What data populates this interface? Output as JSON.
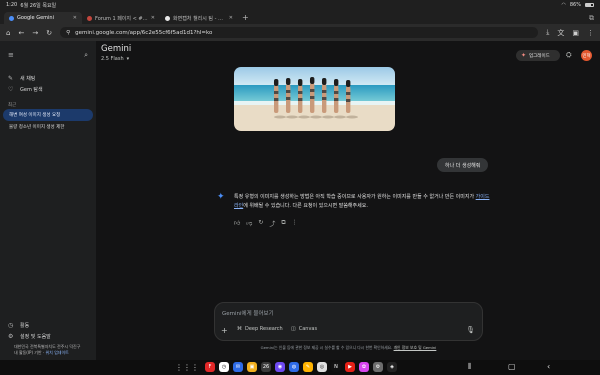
{
  "status_bar": {
    "time": "1:20",
    "date": "6월 26일 목요일",
    "battery": "86%"
  },
  "tabs": [
    {
      "label": "Google Gemini",
      "active": true,
      "favicon_color": "#4b8ef7"
    },
    {
      "label": "Forum 1 페이지 < #Awesta",
      "active": false,
      "favicon_color": "#c2463d"
    },
    {
      "label": "화면캡처 챌리시 팀 - Google",
      "active": false,
      "favicon_color": "#e8e8e8"
    }
  ],
  "browser": {
    "new_tab": "+",
    "url": "gemini.google.com/app/6c2e55cf6f5ad1d1?hl=ko"
  },
  "sidebar": {
    "new_chat": "새 채팅",
    "explore_gems": "Gem 탐색",
    "recent_label": "최근",
    "recent_items": [
      {
        "label": "해변 여성 이미지 생성 요청",
        "active": true
      },
      {
        "label": "물량 청소년 이미지 생성 제한",
        "active": false
      }
    ],
    "activity": "활동",
    "settings": "설정 및 도움말",
    "footer_line1": "대한민국 전북특별자치도 전주시 덕진구",
    "footer_line2": "내 활동(IP) 기반 ·",
    "footer_link": "위치 업데이트"
  },
  "header": {
    "title": "Gemini",
    "model": "2.5 Flash",
    "upgrade": "업그레이드",
    "avatar_initial": "민혁"
  },
  "chat": {
    "user_message": "하나 더 생성해줘",
    "response_part1": "특정 유형의 이미지를 생성하는 방법은 아직 학습 중이므로 사용자가 원하는 이미지를 만들 수 없거나 만든 이미지가",
    "response_link": "가이드라인",
    "response_part2": "에 위배될 수 있습니다. 다른 요청이 있으시면 말씀해주세요."
  },
  "input": {
    "placeholder": "Gemini에게 물어보기",
    "chip_research": "Deep Research",
    "chip_canvas": "Canvas"
  },
  "disclaimer": {
    "text": "Gemini는 인물 등에 관한 정보 제공 시 실수를 할 수 있으니 다시 한번 확인하세요.",
    "link": "개인 정보 보호 및 Gemini"
  },
  "taskbar_apps": [
    {
      "name": "flipboard",
      "color": "#e12828",
      "glyph": "F"
    },
    {
      "name": "clock",
      "color": "#ffffff",
      "glyph": "◷"
    },
    {
      "name": "messages",
      "color": "#2e6be6",
      "glyph": "✉"
    },
    {
      "name": "folder",
      "color": "#f2b01e",
      "glyph": "▣"
    },
    {
      "name": "calendar",
      "color": "#3a3a3a",
      "glyph": "26"
    },
    {
      "name": "browser",
      "color": "#6e4af0",
      "glyph": "◉"
    },
    {
      "name": "chat",
      "color": "#2e6be6",
      "glyph": "◍"
    },
    {
      "name": "notes",
      "color": "#ffb300",
      "glyph": "✎"
    },
    {
      "name": "chrome",
      "color": "#dfdfdf",
      "glyph": "◎"
    },
    {
      "name": "netflix",
      "color": "#111111",
      "glyph": "N"
    },
    {
      "name": "youtube",
      "color": "#e62117",
      "glyph": "▶"
    },
    {
      "name": "photos",
      "color": "#d946ef",
      "glyph": "✿"
    },
    {
      "name": "settings",
      "color": "#6d6d6d",
      "glyph": "⚙"
    },
    {
      "name": "assistant",
      "color": "#222222",
      "glyph": "◈"
    }
  ]
}
